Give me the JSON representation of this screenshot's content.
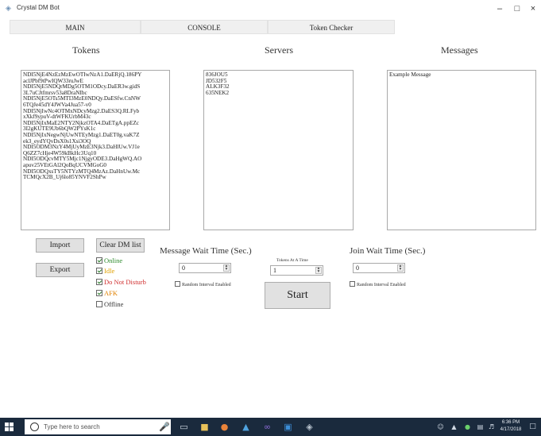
{
  "window": {
    "title": "Crystal DM Bot",
    "minimize": "–",
    "maximize": "□",
    "close": "×"
  },
  "tabs": [
    {
      "label": "MAIN",
      "active": true
    },
    {
      "label": "CONSOLE",
      "active": false
    },
    {
      "label": "Token Checker",
      "active": false
    }
  ],
  "panels": {
    "tokens_heading": "Tokens",
    "servers_heading": "Servers",
    "messages_heading": "Messages"
  },
  "tokens_text": "NDI5NjE4NzEzMzEwOTIwNzA1.DaERjQ.186PY\naclJPbf9tPwIQW33ruJwE\nNDI5NjE5NDQrMDg5OTM1ODcy.DaER3w.gidS\n3L7uCJtfmrsv53a8DraNIbc\nNDI5NjE5OTs5MTI3MzE0NDQy.DaESfw.CnNW\n6TQJe45dY4JWVa4Jua57-v0\nNDI5NjIwNc4OTMxNDcyMzg2.DaES3Q.RLFyb\nxXkf9ypuV-dtWFKUrbM43c\nNDI5NjIxMaE2NTY2NjkzOTA4.DaETgA.ppEZc\n3I2gKUTE9Ub6bQW2PYsK1c\nNDI5NjIxNegwNjUwNTEyMzg1.DaET0g.vaK7Z\nek3_eydYQvDsX0s1Xsi3OQ\nNDI5ODM3NzY4MjUyMzE3Njk3.DaHlUw.VJ1e\nQ6ZZ7cHje4W59kBkHc3Uq10\nNDI5ODQcvMTY5Mjc1NjgyODE3.DaHgWQ.AO\napuv25VEtGAl2QoBqUCVMGoG0\nNDI5ODQxsTY5NTYzMTQ4MzAz.DaHnUw.Mc\nTCMQcX2B_Uj6lo85YNVF2ShPw",
  "servers_text": "836JOU5\nJD532F5\nALK3F32\n635NEK2",
  "messages_text": "Example Message",
  "buttons": {
    "import": "Import",
    "export": "Export",
    "clear_dm_list": "Clear DM list",
    "start": "Start"
  },
  "statuses": [
    {
      "label": "Online",
      "checked": true,
      "color": "#2e8b2e"
    },
    {
      "label": "Idle",
      "checked": true,
      "color": "#e0a000"
    },
    {
      "label": "Do Not Disturb",
      "checked": true,
      "color": "#d03030"
    },
    {
      "label": "AFK",
      "checked": true,
      "color": "#e08000"
    },
    {
      "label": "Offline",
      "checked": false,
      "color": "#333333"
    }
  ],
  "message_wait": {
    "label": "Message Wait Time (Sec.)",
    "value": "0",
    "random_label": "Random Interval Enabled"
  },
  "tokens_at_a_time": {
    "label": "Tokens At A Time",
    "value": "1"
  },
  "join_wait": {
    "label": "Join Wait Time (Sec.)",
    "value": "0",
    "random_label": "Random Interval Enabled"
  },
  "taskbar": {
    "search_placeholder": "Type here to search",
    "time": "6:36 PM",
    "date": "4/17/2018"
  }
}
